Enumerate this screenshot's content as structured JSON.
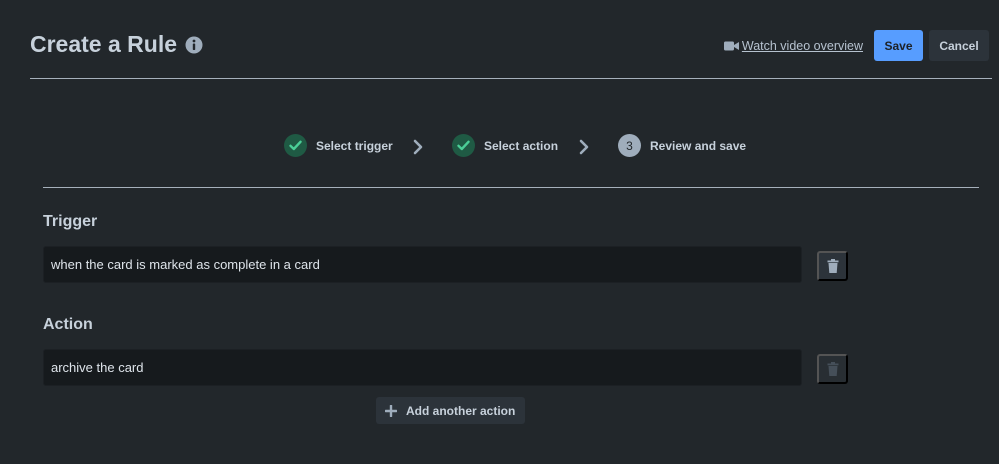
{
  "header": {
    "title": "Create a Rule",
    "info_icon": "info-icon",
    "video_link_label": "Watch video overview",
    "video_icon": "video-camera-icon",
    "save_label": "Save",
    "cancel_label": "Cancel"
  },
  "steps": [
    {
      "label": "Select trigger",
      "state": "done",
      "icon": "check-icon"
    },
    {
      "label": "Select action",
      "state": "done",
      "icon": "check-icon"
    },
    {
      "label": "Review and save",
      "state": "current",
      "number": "3"
    }
  ],
  "trigger": {
    "title": "Trigger",
    "value": "when the card is marked as complete in a card",
    "delete_icon": "trash-icon"
  },
  "action": {
    "title": "Action",
    "value": "archive the card",
    "delete_icon": "trash-icon",
    "delete_disabled": true,
    "add_label": "Add another action",
    "add_icon": "plus-icon"
  },
  "colors": {
    "background": "#22272b",
    "primary_button": "#579dff",
    "step_done": "#1f5a44",
    "step_check": "#4bce97",
    "field_bg": "#161a1d"
  }
}
